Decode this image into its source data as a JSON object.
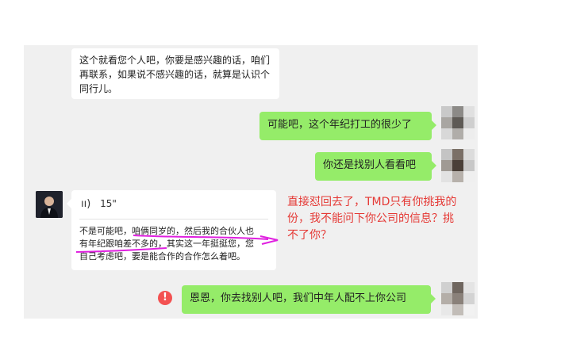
{
  "messages": {
    "m1_lines": [
      "这个就看您个人吧，你要是感兴趣的话，咱们",
      "再联系，如果说不感兴趣的话，就算是认识个",
      "同行儿。"
    ],
    "m2": "可能吧，这个年纪打工的很少了",
    "m3": "你还是找别人看看吧",
    "voice_duration": "15\"",
    "voice_lines": [
      "不是可能吧，咱俩同岁的，然后我的合伙人也",
      "有年纪跟咱差不多的，其实这一年挺挺您，您",
      "自己考虑吧，要是能合作的合作怎么着吧。"
    ],
    "m5": "恩恩，你去找别人吧，我们中年人配不上你公司"
  },
  "annotation_lines": [
    "直接怼回去了，TMD只有你挑我的",
    "份，我不能问下你公司的信息？挑",
    "不了你？"
  ],
  "icons": {
    "send_failed": "!"
  },
  "colors": {
    "green_bubble": "#95ec69",
    "annotation": "#e53935",
    "marker_line": "#e020e0",
    "error": "#f35151"
  }
}
